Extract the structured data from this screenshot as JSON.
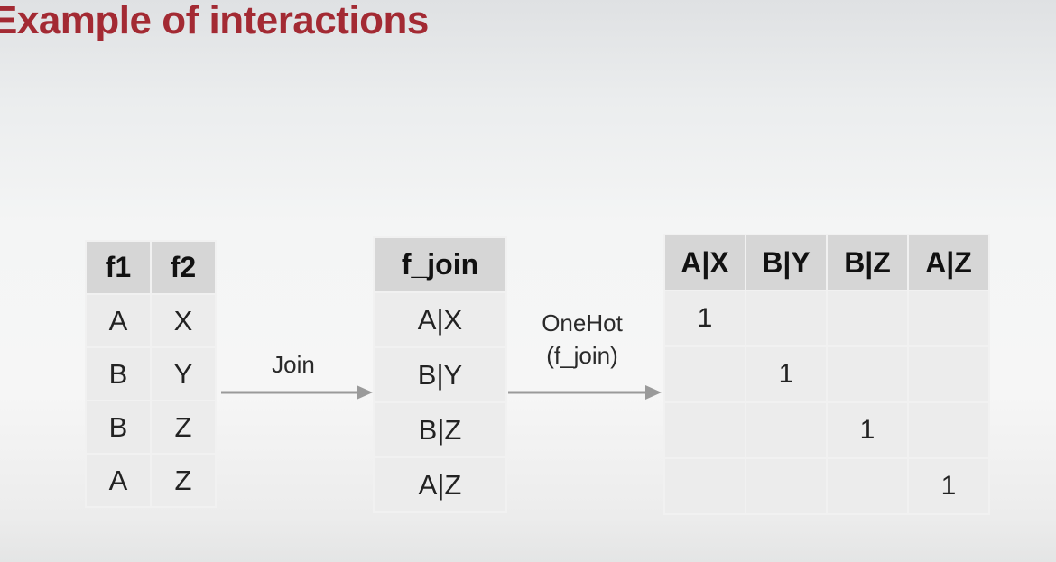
{
  "slide": {
    "title": "Example of interactions"
  },
  "input_table": {
    "headers": [
      "f1",
      "f2"
    ],
    "rows": [
      [
        "A",
        "X"
      ],
      [
        "B",
        "Y"
      ],
      [
        "B",
        "Z"
      ],
      [
        "A",
        "Z"
      ]
    ]
  },
  "join_step": {
    "label": "Join"
  },
  "join_table": {
    "header": "f_join",
    "rows": [
      "A|X",
      "B|Y",
      "B|Z",
      "A|Z"
    ]
  },
  "onehot_step": {
    "line1": "OneHot",
    "line2": "(f_join)"
  },
  "onehot_table": {
    "headers": [
      "A|X",
      "B|Y",
      "B|Z",
      "A|Z"
    ],
    "rows": [
      [
        "1",
        "",
        "",
        ""
      ],
      [
        "",
        "1",
        "",
        ""
      ],
      [
        "",
        "",
        "1",
        ""
      ],
      [
        "",
        "",
        "",
        "1"
      ]
    ]
  },
  "colors": {
    "title": "#a32a33",
    "header_fill": "#d6d6d6",
    "cell_fill": "#ececec",
    "arrow": "#9a9a9a"
  }
}
